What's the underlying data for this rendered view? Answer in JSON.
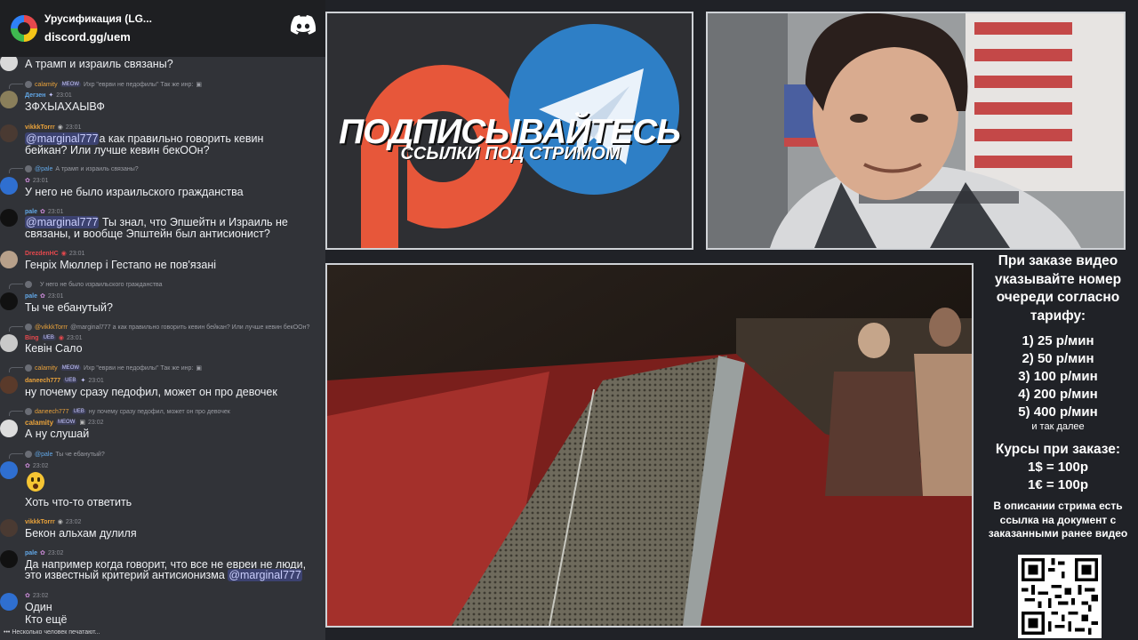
{
  "server": {
    "name": "Урусификация (LG...",
    "link": "discord.gg/uem"
  },
  "chat": {
    "messages": [
      {
        "text": "А трамп и израиль связаны?"
      },
      {
        "reply_author": "calamity",
        "reply_badge": "MEOW",
        "reply_text": "Ихр \"еврви не педофилы\" Так же инр:",
        "author": "Дегзен",
        "time": "23:01",
        "text": "ЗФХЫАХАЫВФ"
      },
      {
        "author": "vikkkTorrr",
        "time": "23:01",
        "mention": "@marginal777",
        "text": "а как правильно говорить кевин",
        "text2": "бейкан? Или лучше кевин бекООн?"
      },
      {
        "reply_author": "@pale",
        "reply_text": "А трамп и израиль связаны?",
        "time": "23:01",
        "text": "У него не было израильского гражданства"
      },
      {
        "author": "pale",
        "time": "23:01",
        "mention": "@marginal777",
        "text": " Ты знал, что Эпшейтн и Израиль не",
        "text2": "связаны, и вообще Эпштейн был антисионист?"
      },
      {
        "author": "DrezdenHC",
        "time": "23:01",
        "text": "Генріх Мюллер і Гестапо не пов'язані"
      },
      {
        "reply_text": "У него не было израильского гражданства",
        "author": "pale",
        "time": "23:01",
        "text": "Ты че ебанутый?"
      },
      {
        "reply_author": "@vikkkTorrr",
        "reply_text": "@marginal777 а как правильно говорить кевин бейкан? Или лучше кевин бекООн?",
        "author": "Bing",
        "badge": "UEB",
        "time": "23:01",
        "text": "Кевін Сало"
      },
      {
        "reply_author": "calamity",
        "reply_badge": "MEOW",
        "reply_text": "Ихр \"еврви не педофилы\" Так же инр:",
        "author": "daneech777",
        "badge": "UEB",
        "time": "23:01",
        "text": "ну почему сразу педофил, может он про девочек"
      },
      {
        "reply_author": "daneech777",
        "reply_badge": "UEB",
        "reply_text": "ну почему сразу педофил, может он про девочек",
        "author": "calamity",
        "badge": "MEOW",
        "time": "23:02",
        "text": "А ну слушай"
      },
      {
        "reply_author": "@pale",
        "reply_text": "Ты че ебанутый?",
        "time": "23:02",
        "text": "Хоть что-то ответить"
      },
      {
        "author": "vikkkTorrr",
        "time": "23:02",
        "text": "Бекон альхам дулиля"
      },
      {
        "author": "pale",
        "time": "23:02",
        "text": "Да например когда говорит, что все не евреи не люди,",
        "text2": "это известный критерий антисионизма ",
        "mention2": "@marginal777"
      },
      {
        "time": "23:02",
        "text": "Один",
        "text2": "Кто ещё"
      }
    ],
    "typing": "Несколько человек печатают..."
  },
  "banner": {
    "title": "ПОДПИСЫВАЙТЕСЬ",
    "subtitle": "ССЫЛКИ ПОД СТРИМОМ"
  },
  "info": {
    "title": "При заказе видео указывайте номер очереди согласно тарифу:",
    "tariffs": [
      "1) 25 р/мин",
      "2) 50 р/мин",
      "3) 100 р/мин",
      "4) 200 р/мин",
      "5) 400 р/мин"
    ],
    "more": "и так далее",
    "course_title": "Курсы при заказе:",
    "courses": [
      "1$ = 100р",
      "1€ = 100р"
    ],
    "desc": "В описании стрима есть ссылка на документ с заказанными ранее видео"
  },
  "colors": {
    "author_orange": "#e9a23b",
    "author_blue": "#62a8e8",
    "author_green": "#4cc873",
    "author_red": "#e5484d",
    "mention_bg": "#3c4270"
  }
}
